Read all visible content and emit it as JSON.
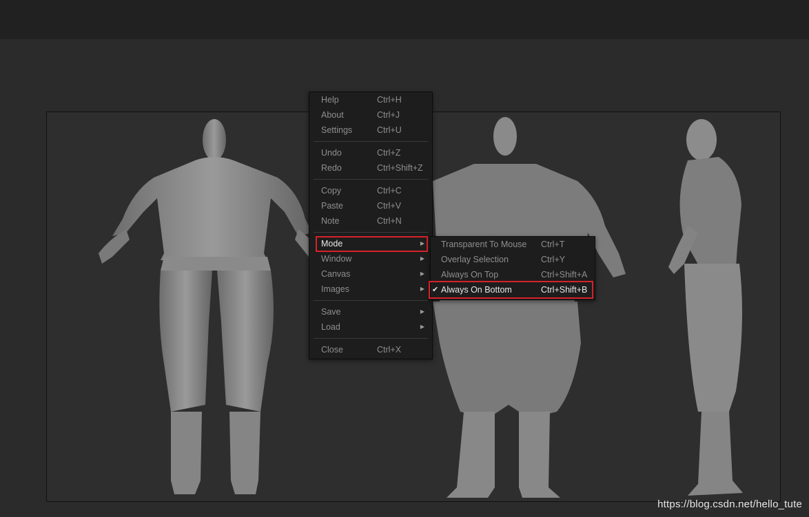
{
  "main_menu": [
    {
      "label": "Help",
      "shortcut": "Ctrl+H"
    },
    {
      "label": "About",
      "shortcut": "Ctrl+J"
    },
    {
      "label": "Settings",
      "shortcut": "Ctrl+U"
    },
    {
      "label": "Undo",
      "shortcut": "Ctrl+Z"
    },
    {
      "label": "Redo",
      "shortcut": "Ctrl+Shift+Z"
    },
    {
      "label": "Copy",
      "shortcut": "Ctrl+C"
    },
    {
      "label": "Paste",
      "shortcut": "Ctrl+V"
    },
    {
      "label": "Note",
      "shortcut": "Ctrl+N"
    },
    {
      "label": "Mode"
    },
    {
      "label": "Window"
    },
    {
      "label": "Canvas"
    },
    {
      "label": "Images"
    },
    {
      "label": "Save"
    },
    {
      "label": "Load"
    },
    {
      "label": "Close",
      "shortcut": "Ctrl+X"
    }
  ],
  "mode_submenu": [
    {
      "label": "Transparent To Mouse",
      "shortcut": "Ctrl+T"
    },
    {
      "label": "Overlay Selection",
      "shortcut": "Ctrl+Y"
    },
    {
      "label": "Always On Top",
      "shortcut": "Ctrl+Shift+A"
    },
    {
      "label": "Always On Bottom",
      "shortcut": "Ctrl+Shift+B",
      "checked": true
    }
  ],
  "watermark": "https://blog.csdn.net/hello_tute",
  "colors": {
    "highlight_border": "#d7222a",
    "menu_bg": "#1d1d1d",
    "menu_text": "#8f8f8f",
    "active_text": "#e8e8e8"
  }
}
